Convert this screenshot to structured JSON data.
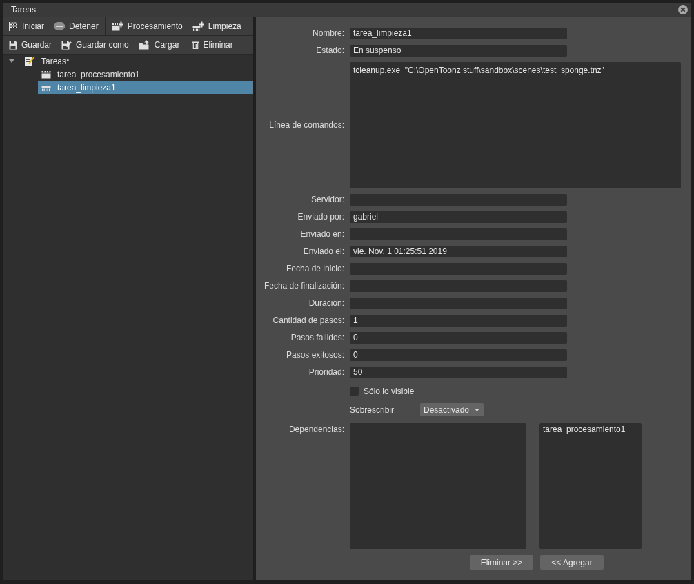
{
  "window": {
    "title": "Tareas"
  },
  "toolbars": [
    {
      "groups": [
        {
          "buttons": [
            {
              "label": "Iniciar",
              "kind": "start"
            },
            {
              "label": "Detener",
              "kind": "stop"
            }
          ]
        },
        {
          "buttons": [
            {
              "label": "Procesamiento",
              "kind": "render"
            },
            {
              "label": "Limpieza",
              "kind": "cleanup"
            }
          ]
        }
      ]
    },
    {
      "groups": [
        {
          "buttons": [
            {
              "label": "Guardar",
              "kind": "save"
            },
            {
              "label": "Guardar como",
              "kind": "saveas"
            },
            {
              "label": "Cargar",
              "kind": "load"
            }
          ]
        },
        {
          "buttons": [
            {
              "label": "Eliminar",
              "kind": "delete"
            }
          ]
        }
      ]
    }
  ],
  "tree": {
    "label": "Tareas*",
    "kind": "tasklist",
    "expanded": true,
    "selected": false,
    "children": [
      {
        "label": "tarea_procesamiento1",
        "kind": "render",
        "selected": false
      },
      {
        "label": "tarea_limpieza1",
        "kind": "cleanup",
        "selected": true
      }
    ]
  },
  "form": {
    "fields": [
      {
        "label": "Nombre:",
        "kind": "line",
        "value": "tarea_limpieza1"
      },
      {
        "label": "Estado:",
        "kind": "line",
        "value": "En suspenso"
      },
      {
        "label": "Línea de comandos:",
        "kind": "multiline",
        "value": "tcleanup.exe  \"C:\\OpenToonz stuff\\sandbox\\scenes\\test_sponge.tnz\""
      },
      {
        "label": "Servidor:",
        "kind": "line"
      },
      {
        "label": "Enviado por:",
        "kind": "line",
        "value": "gabriel"
      },
      {
        "label": "Enviado en:",
        "kind": "line"
      },
      {
        "label": "Enviado el:",
        "kind": "line",
        "value": "vie. Nov. 1 01:25:51 2019"
      },
      {
        "label": "Fecha de inicio:",
        "kind": "line"
      },
      {
        "label": "Fecha de finalización:",
        "kind": "line"
      },
      {
        "label": "Duración:",
        "kind": "line"
      },
      {
        "label": "Cantidad de pasos:",
        "kind": "line",
        "value": "1"
      },
      {
        "label": "Pasos fallidos:",
        "kind": "line",
        "value": "0"
      },
      {
        "label": "Pasos exitosos:",
        "kind": "line",
        "value": "0"
      },
      {
        "label": "Prioridad:",
        "kind": "line",
        "value": "50"
      }
    ],
    "visible_only": {
      "label": "Sólo lo visible",
      "checked": false
    },
    "overwrite": {
      "label": "Sobrescribir",
      "value": "Desactivado"
    },
    "dependencies": {
      "label": "Dependencias:",
      "right_list": [
        {
          "label": "tarea_procesamiento1",
          "selected": false
        }
      ]
    },
    "buttons": [
      "Eliminar >>",
      "<< Agregar"
    ]
  }
}
